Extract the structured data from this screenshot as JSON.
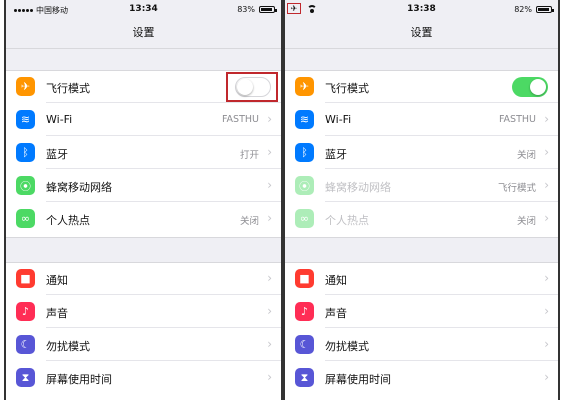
{
  "left": {
    "status": {
      "carrier": "中国移动",
      "time": "13:34",
      "battery_text": "83%",
      "battery_level": 0.83
    },
    "title": "设置",
    "group1": [
      {
        "icon": "airplane-icon",
        "color": "#ff9500",
        "glyph": "✈",
        "label": "飞行模式",
        "toggle": "off"
      },
      {
        "icon": "wifi-icon",
        "color": "#007aff",
        "glyph": "≋",
        "label": "Wi-Fi",
        "value": "FASTHU"
      },
      {
        "icon": "bluetooth-icon",
        "color": "#007aff",
        "glyph": "ᛒ",
        "label": "蓝牙",
        "value": "打开"
      },
      {
        "icon": "cellular-icon",
        "color": "#4cd964",
        "glyph": "⦿",
        "label": "蜂窝移动网络",
        "value": ""
      },
      {
        "icon": "hotspot-icon",
        "color": "#4cd964",
        "glyph": "∞",
        "label": "个人热点",
        "value": "关闭"
      }
    ],
    "group2": [
      {
        "icon": "notifications-icon",
        "color": "#ff3b30",
        "glyph": "■",
        "label": "通知"
      },
      {
        "icon": "sounds-icon",
        "color": "#ff2d55",
        "glyph": "♪",
        "label": "声音"
      },
      {
        "icon": "do-not-disturb-icon",
        "color": "#5856d6",
        "glyph": "☾",
        "label": "勿扰模式"
      },
      {
        "icon": "screen-time-icon",
        "color": "#5856d6",
        "glyph": "⧗",
        "label": "屏幕使用时间"
      }
    ]
  },
  "right": {
    "status": {
      "carrier": "",
      "time": "13:38",
      "battery_text": "82%",
      "battery_level": 0.82
    },
    "title": "设置",
    "group1": [
      {
        "icon": "airplane-icon",
        "color": "#ff9500",
        "glyph": "✈",
        "label": "飞行模式",
        "toggle": "on"
      },
      {
        "icon": "wifi-icon",
        "color": "#007aff",
        "glyph": "≋",
        "label": "Wi-Fi",
        "value": "FASTHU"
      },
      {
        "icon": "bluetooth-icon",
        "color": "#007aff",
        "glyph": "ᛒ",
        "label": "蓝牙",
        "value": "关闭"
      },
      {
        "icon": "cellular-icon",
        "color": "#4cd964",
        "glyph": "⦿",
        "label": "蜂窝移动网络",
        "value": "飞行模式",
        "dim": true
      },
      {
        "icon": "hotspot-icon",
        "color": "#4cd964",
        "glyph": "∞",
        "label": "个人热点",
        "value": "关闭",
        "dim": true
      }
    ],
    "group2": [
      {
        "icon": "notifications-icon",
        "color": "#ff3b30",
        "glyph": "■",
        "label": "通知"
      },
      {
        "icon": "sounds-icon",
        "color": "#ff2d55",
        "glyph": "♪",
        "label": "声音"
      },
      {
        "icon": "do-not-disturb-icon",
        "color": "#5856d6",
        "glyph": "☾",
        "label": "勿扰模式"
      },
      {
        "icon": "screen-time-icon",
        "color": "#5856d6",
        "glyph": "⧗",
        "label": "屏幕使用时间"
      }
    ]
  }
}
